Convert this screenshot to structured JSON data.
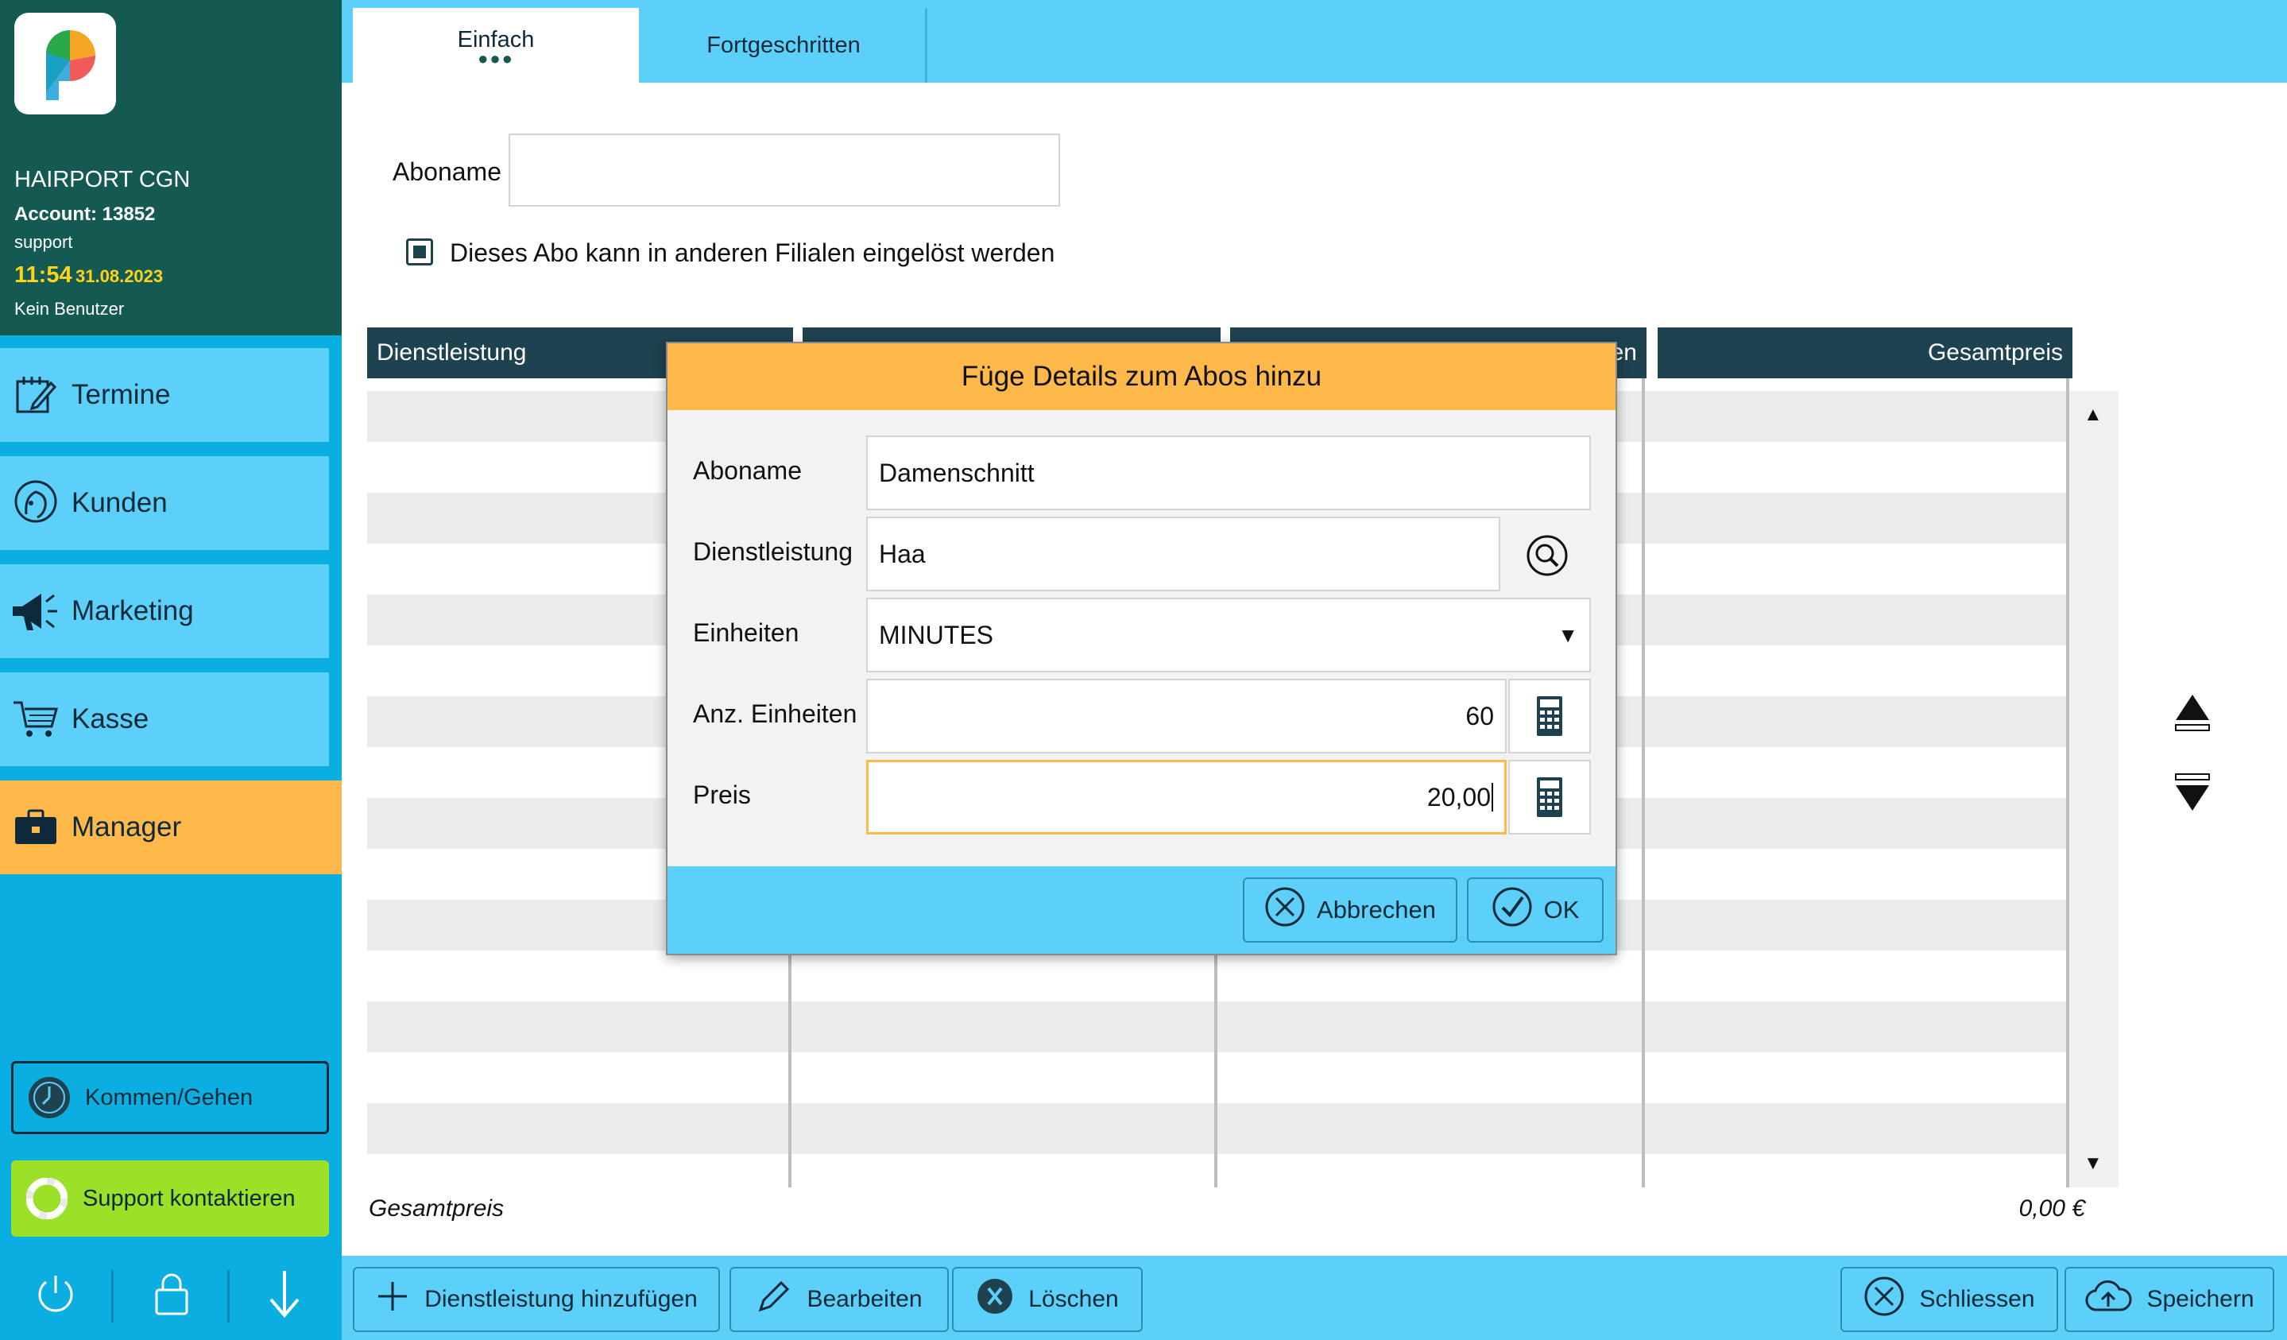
{
  "sidebar": {
    "salon": "HAIRPORT CGN",
    "account": "Account: 13852",
    "user_role": "support",
    "time": "11:54",
    "date": "31.08.2023",
    "no_user": "Kein Benutzer",
    "nav": [
      {
        "label": "Termine",
        "icon": "calendar-edit-icon"
      },
      {
        "label": "Kunden",
        "icon": "customer-head-icon"
      },
      {
        "label": "Marketing",
        "icon": "megaphone-icon"
      },
      {
        "label": "Kasse",
        "icon": "cart-icon"
      },
      {
        "label": "Manager",
        "icon": "briefcase-icon",
        "active": true
      }
    ],
    "clock_in_out": "Kommen/Gehen",
    "support_contact": "Support kontaktieren"
  },
  "tabs": [
    {
      "label": "Einfach",
      "active": true
    },
    {
      "label": "Fortgeschritten",
      "active": false
    }
  ],
  "form": {
    "aboname_label": "Aboname",
    "aboname_value": "",
    "multi_branch_label": "Dieses Abo kann in anderen Filialen eingelöst werden",
    "multi_branch_checked": true
  },
  "table": {
    "columns": [
      "Dienstleistung",
      "",
      "en",
      "Gesamtpreis"
    ],
    "total_label": "Gesamtpreis",
    "total_value": "0,00 €"
  },
  "dialog": {
    "title": "Füge Details zum Abos hinzu",
    "aboname_label": "Aboname",
    "aboname_value": "Damenschnitt",
    "service_label": "Dienstleistung",
    "service_value": "Haa",
    "units_label": "Einheiten",
    "units_value": "MINUTES",
    "unit_count_label": "Anz. Einheiten",
    "unit_count_value": "60",
    "price_label": "Preis",
    "price_value": "20,00",
    "cancel_label": "Abbrechen",
    "ok_label": "OK"
  },
  "toolbar": {
    "add_service": "Dienstleistung hinzufügen",
    "edit": "Bearbeiten",
    "delete": "Löschen",
    "close": "Schliessen",
    "save": "Speichern"
  },
  "colors": {
    "sidebar_header": "#155a52",
    "sidebar": "#0aaee0",
    "nav_item": "#5cd0f8",
    "active": "#ffb94a",
    "support": "#9de028",
    "table_header": "#1f4250"
  }
}
